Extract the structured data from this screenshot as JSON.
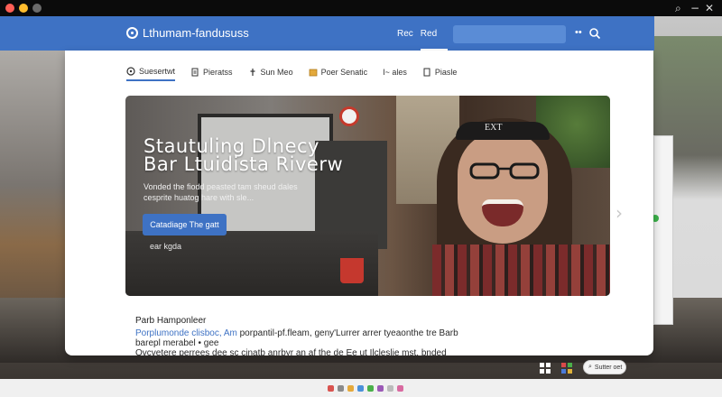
{
  "browser": {
    "brand": "Lthumam-fandususs",
    "nav_links": [
      "Rec",
      "Red"
    ],
    "nav_more": "••"
  },
  "tabs": [
    {
      "label": "Suesertwt",
      "icon": "circle-icon",
      "active": true
    },
    {
      "label": "Pieratss",
      "icon": "document-icon",
      "active": false
    },
    {
      "label": "Sun Meo",
      "icon": "pin-icon",
      "active": false
    },
    {
      "label": "Poer Senatic",
      "icon": "folder-icon",
      "active": false
    },
    {
      "label": "I~ ales",
      "icon": "",
      "active": false
    },
    {
      "label": "Piasle",
      "icon": "document-icon",
      "active": false
    }
  ],
  "hero": {
    "title_line1": "Stautuling  Dlnecy",
    "title_line2": "Bar Ltuidista Riverw",
    "subtitle": "Vonded the fiodd peasted tam sheud dales cesprite huatog hare with sle...",
    "button_label": "Catadiage The gatt",
    "secondary_link": "ear kgda",
    "headband_text": "EXT"
  },
  "section": {
    "heading": "Parb Hamponleer",
    "line1_link": "Porplumonde clisboc, Am",
    "line1_rest": " porpantil-pf.fleam, geny'Lurrer arrer tyeaonthe tre Barb",
    "line2": "barepl merabel • gee",
    "line3": "Ovcvetere perrees dee sc cinatb anrbyr an af the de Ee ut Ilcleslie mst. bnded"
  },
  "bottom": {
    "search_label": "Sutter oet"
  },
  "colors": {
    "accent": "#3e72c4",
    "nav": "#3e72c4"
  }
}
